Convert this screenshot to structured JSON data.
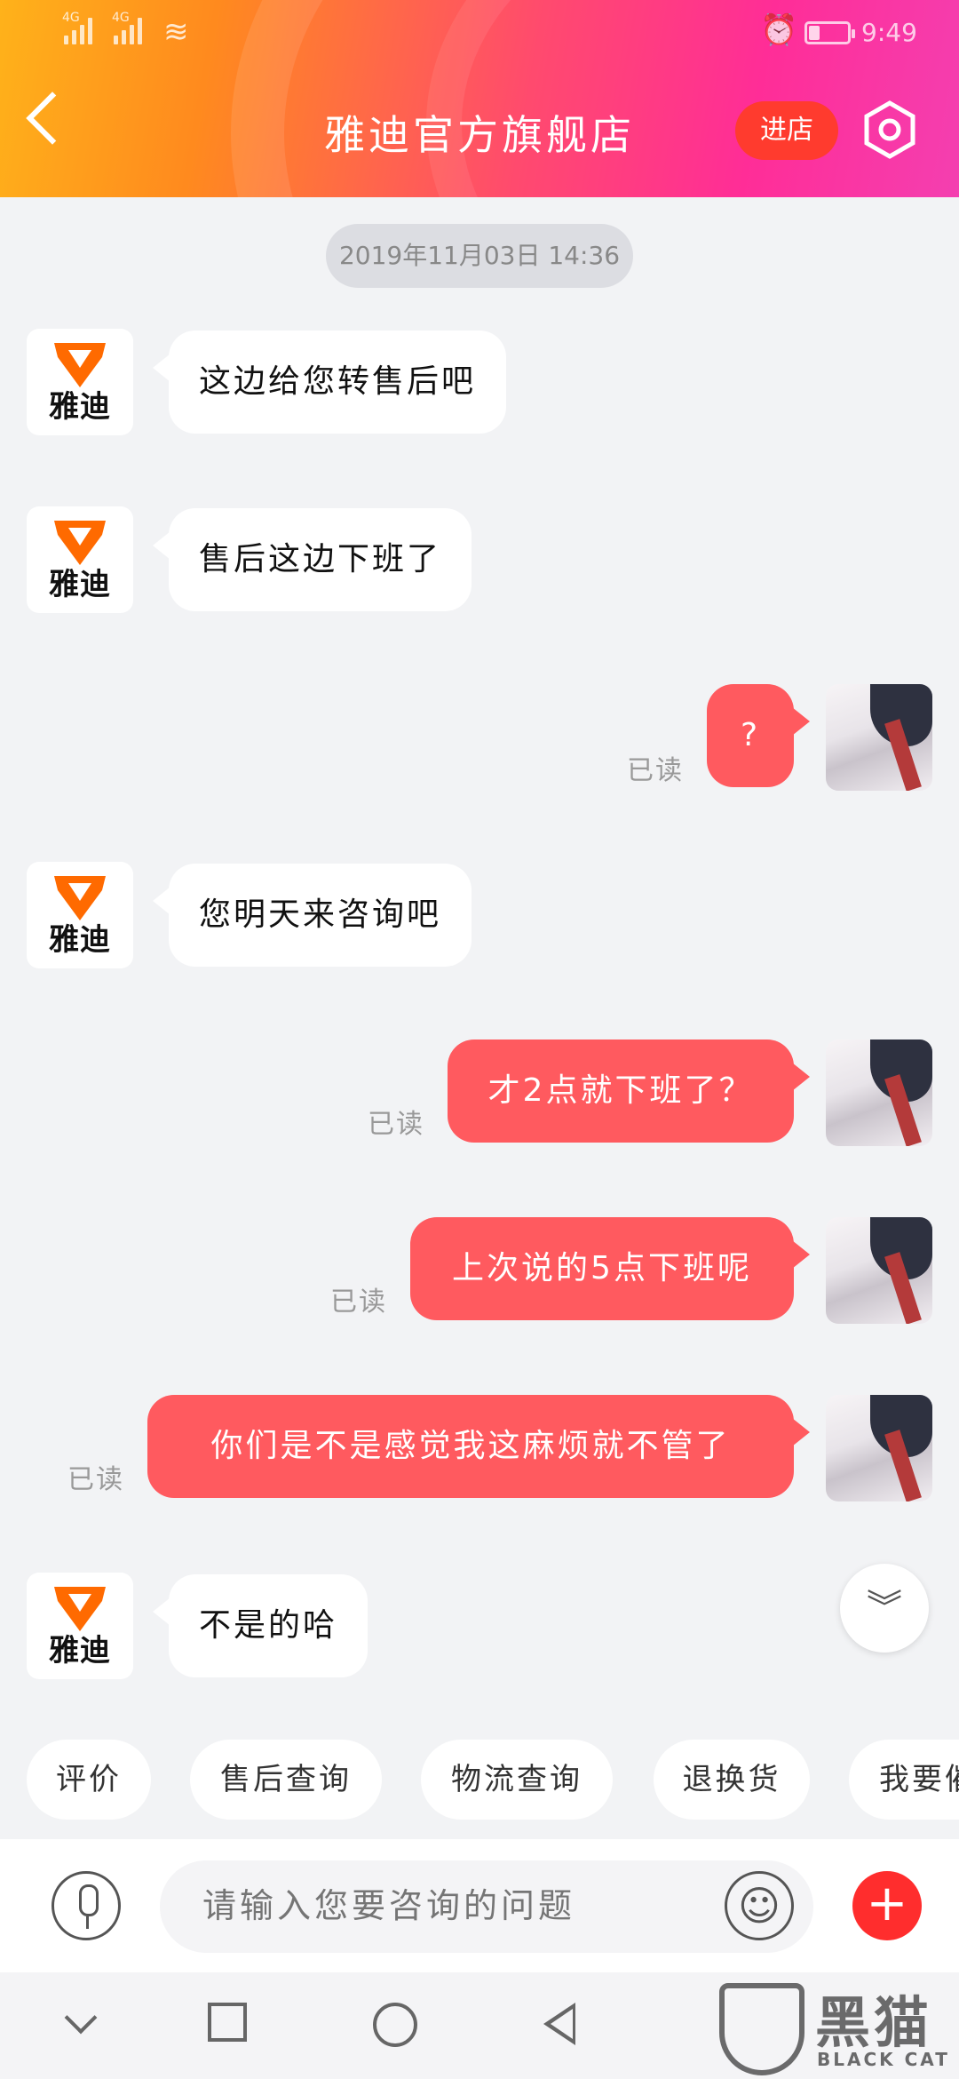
{
  "status_bar": {
    "signal1": "4G",
    "signal2": "4G",
    "time": "9:49"
  },
  "header": {
    "title": "雅迪官方旗舰店",
    "enter_store": "进店"
  },
  "timestamp": "2019年11月03日 14:36",
  "shop": {
    "logo_text": "雅迪",
    "brand_color": "#ff6a00"
  },
  "messages": [
    {
      "side": "in",
      "text": "这边给您转售后吧"
    },
    {
      "side": "in",
      "text": "售后这边下班了"
    },
    {
      "side": "out",
      "text": "?",
      "status": "已读"
    },
    {
      "side": "in",
      "text": "您明天来咨询吧"
    },
    {
      "side": "out",
      "text": "才2点就下班了？",
      "status": "已读"
    },
    {
      "side": "out",
      "text": "上次说的5点下班呢",
      "status": "已读"
    },
    {
      "side": "out",
      "text": "你们是不是感觉我这麻烦就不管了",
      "status": "已读"
    },
    {
      "side": "in",
      "text": "不是的哈"
    }
  ],
  "quick_replies": [
    "评价",
    "售后查询",
    "物流查询",
    "退换货",
    "我要催"
  ],
  "input": {
    "placeholder": "请输入您要咨询的问题"
  },
  "watermark": {
    "cn": "黑猫",
    "en": "BLACK CAT"
  },
  "colors": {
    "accent_red": "#ff5a5f",
    "plus_red": "#ff2d2d"
  },
  "icons": [
    "back-icon",
    "settings-icon",
    "scroll-down-icon",
    "microphone-icon",
    "emoji-icon",
    "plus-icon"
  ]
}
